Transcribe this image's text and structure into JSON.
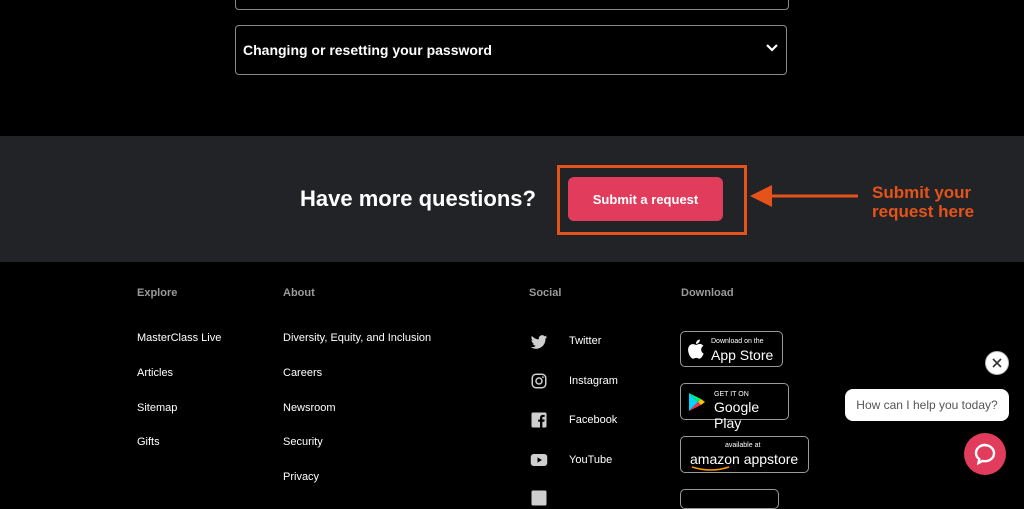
{
  "faq": {
    "item_label": "Changing or resetting your password"
  },
  "band": {
    "question": "Have more questions?",
    "submit_label": "Submit a request",
    "annotation_line1": "Submit your",
    "annotation_line2": "request here"
  },
  "footer": {
    "explore": {
      "heading": "Explore",
      "links": [
        "MasterClass Live",
        "Articles",
        "Sitemap",
        "Gifts"
      ]
    },
    "about": {
      "heading": "About",
      "links": [
        "Diversity, Equity, and Inclusion",
        "Careers",
        "Newsroom",
        "Security",
        "Privacy"
      ]
    },
    "social": {
      "heading": "Social",
      "items": [
        {
          "label": "Twitter",
          "icon": "twitter-icon"
        },
        {
          "label": "Instagram",
          "icon": "instagram-icon"
        },
        {
          "label": "Facebook",
          "icon": "facebook-icon"
        },
        {
          "label": "YouTube",
          "icon": "youtube-icon"
        }
      ]
    },
    "download": {
      "heading": "Download",
      "app_store_small": "Download on the",
      "app_store_big": "App Store",
      "google_small": "GET IT ON",
      "google_big": "Google Play",
      "amazon_small": "available at",
      "amazon_big": "amazon appstore"
    }
  },
  "chat": {
    "prompt": "How can I help you today?"
  },
  "colors": {
    "accent": "#e23c5d",
    "annotation": "#e5531a",
    "band": "#222326"
  }
}
